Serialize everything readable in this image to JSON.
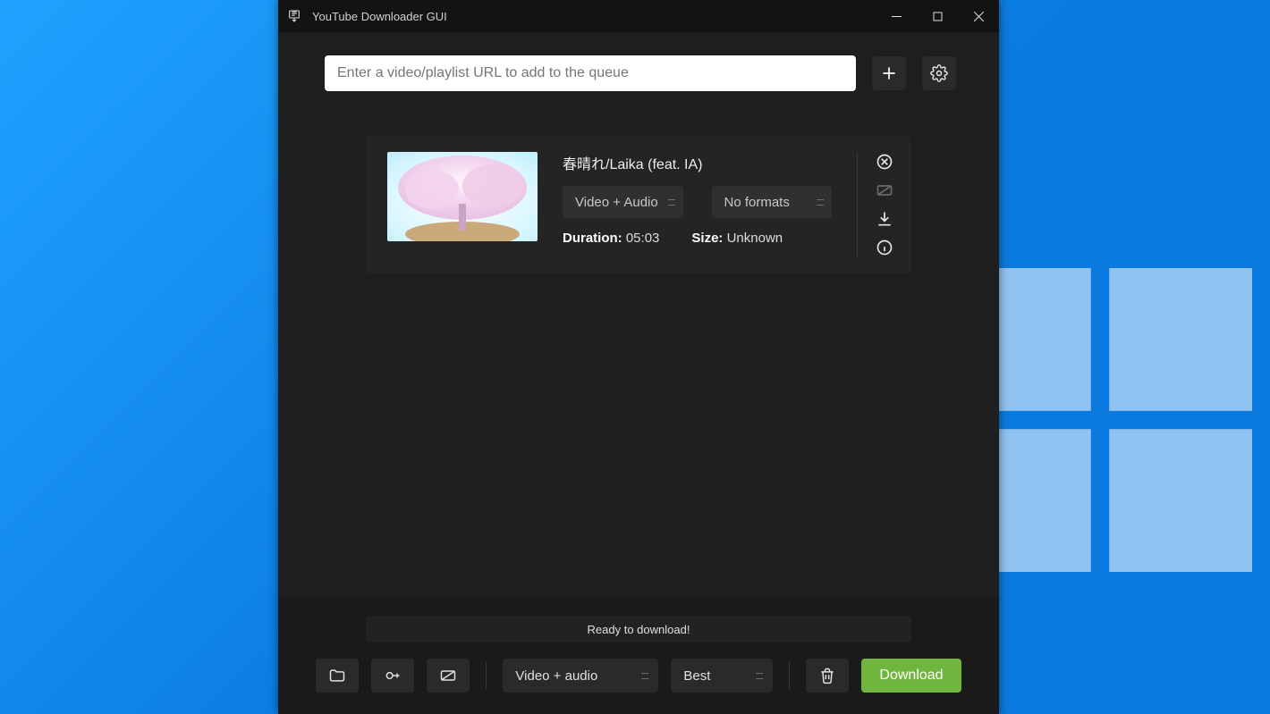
{
  "window": {
    "title": "YouTube Downloader GUI"
  },
  "urlbar": {
    "placeholder": "Enter a video/playlist URL to add to the queue"
  },
  "queue": {
    "items": [
      {
        "title": "春晴れ/Laika (feat. IA)",
        "mode": "Video + Audio",
        "format": "No formats",
        "duration_label": "Duration:",
        "duration": "05:03",
        "size_label": "Size:",
        "size": "Unknown"
      }
    ]
  },
  "status": {
    "text": "Ready to download!"
  },
  "toolbar": {
    "mode": "Video + audio",
    "quality": "Best",
    "download": "Download"
  }
}
